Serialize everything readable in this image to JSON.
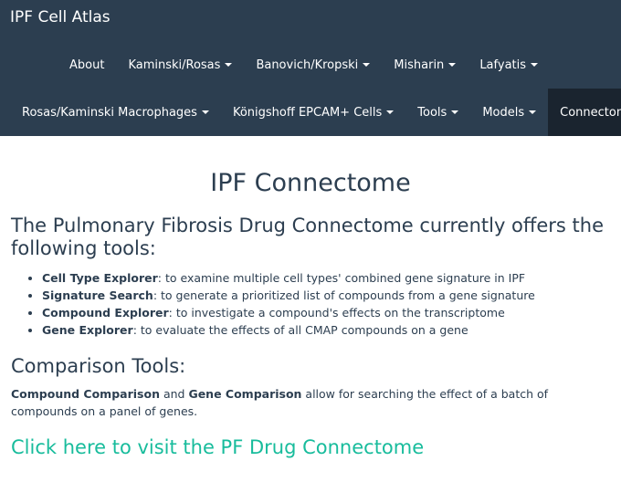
{
  "navbar": {
    "brand": "IPF Cell Atlas",
    "row1": [
      {
        "label": "About",
        "dropdown": false
      },
      {
        "label": "Kaminski/Rosas",
        "dropdown": true
      },
      {
        "label": "Banovich/Kropski",
        "dropdown": true
      },
      {
        "label": "Misharin",
        "dropdown": true
      },
      {
        "label": "Lafyatis",
        "dropdown": true
      }
    ],
    "row2": [
      {
        "label": "Rosas/Kaminski Macrophages",
        "dropdown": true
      },
      {
        "label": "Königshoff EPCAM+ Cells",
        "dropdown": true
      },
      {
        "label": "Tools",
        "dropdown": true
      },
      {
        "label": "Models",
        "dropdown": true
      },
      {
        "label": "Connectome",
        "dropdown": false,
        "active": true
      }
    ]
  },
  "main": {
    "title": "IPF Connectome",
    "intro_heading": "The Pulmonary Fibrosis Drug Connectome currently offers the following tools:",
    "tools": [
      {
        "name": "Cell Type Explorer",
        "desc": ": to examine multiple cell types' combined gene signature in IPF"
      },
      {
        "name": "Signature Search",
        "desc": ": to generate a prioritized list of compounds from a gene signature"
      },
      {
        "name": "Compound Explorer",
        "desc": ": to investigate a compound's effects on the transcriptome"
      },
      {
        "name": "Gene Explorer",
        "desc": ": to evaluate the effects of all CMAP compounds on a gene"
      }
    ],
    "comparison_heading": "Comparison Tools:",
    "comparison": {
      "term1": "Compound Comparison",
      "connector": " and ",
      "term2": "Gene Comparison",
      "rest": " allow for searching the effect of a batch of compounds on a panel of genes."
    },
    "visit_link": "Click here to visit the PF Drug Connectome"
  },
  "colors": {
    "navbar_bg": "#2c3e50",
    "active_bg": "#1a242f",
    "link": "#18bc9c",
    "text": "#2c3e50"
  }
}
